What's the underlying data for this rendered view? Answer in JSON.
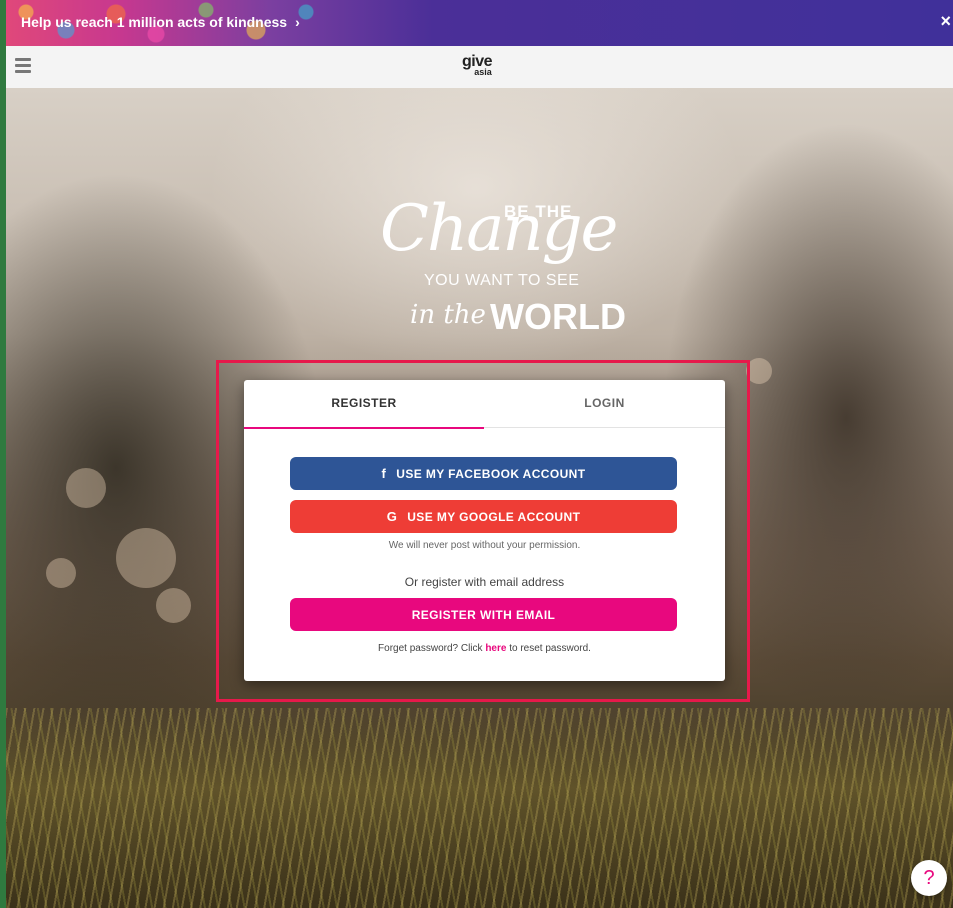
{
  "announcement": {
    "text": "Help us reach 1 million acts of kindness",
    "chevron": "›",
    "close": "×"
  },
  "header": {
    "logo_top": "give",
    "logo_bottom": "asia",
    "menu_icon": "hamburger-icon"
  },
  "slogan": {
    "line_be": "BE THE",
    "line_change": "Change",
    "line_want": "YOU WANT TO SEE",
    "line_inthe": "in the",
    "line_world": "WORLD"
  },
  "auth_card": {
    "tabs": [
      {
        "label": "REGISTER",
        "active": true
      },
      {
        "label": "LOGIN",
        "active": false
      }
    ],
    "facebook_button": {
      "icon": "facebook-icon",
      "icon_glyph": "f",
      "label": "USE MY FACEBOOK ACCOUNT",
      "color": "#2e5596"
    },
    "google_button": {
      "icon": "google-icon",
      "icon_glyph": "G",
      "label": "USE MY GOOGLE ACCOUNT",
      "color": "#ee3d36"
    },
    "permission_note": "We will never post without your permission.",
    "or_text": "Or register with email address",
    "email_button": {
      "label": "REGISTER WITH EMAIL",
      "color": "#e8087e"
    },
    "forgot_prefix": "Forget password? Click",
    "forgot_link": "here",
    "forgot_suffix": "to reset password."
  },
  "help": {
    "glyph": "?",
    "icon": "help-icon"
  },
  "colors": {
    "accent": "#e8087e",
    "highlight_box": "#e6194b",
    "announcement_bar": "#40309a"
  }
}
